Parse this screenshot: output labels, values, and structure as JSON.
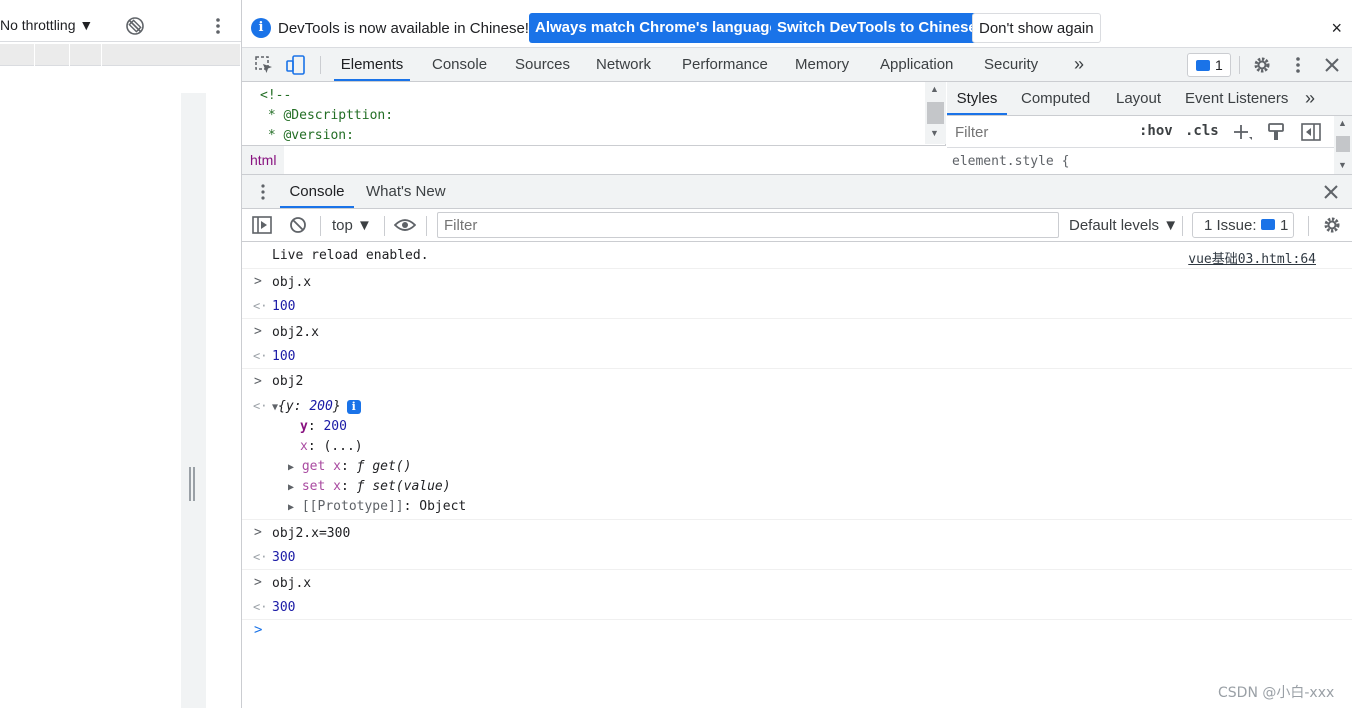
{
  "device_toolbar": {
    "throttling": "No throttling",
    "rotate_icon": "rotate-icon",
    "more_icon": "kebab-icon"
  },
  "infobar": {
    "message": "DevTools is now available in Chinese!",
    "btn_match": "Always match Chrome's language",
    "btn_switch": "Switch DevTools to Chinese",
    "btn_dismiss": "Don't show again",
    "close": "×"
  },
  "main_tabs": [
    "Elements",
    "Console",
    "Sources",
    "Network",
    "Performance",
    "Memory",
    "Application",
    "Security"
  ],
  "more_tabs": "»",
  "issues_count": "1",
  "elements": {
    "lines": [
      "<!--",
      " * @Descripttion:",
      " * @version:"
    ],
    "breadcrumb": "html"
  },
  "styles": {
    "tabs": [
      "Styles",
      "Computed",
      "Layout",
      "Event Listeners"
    ],
    "filter_placeholder": "Filter",
    "hov": ":hov",
    "cls": ".cls",
    "element_style": "element.style {"
  },
  "drawer": {
    "tabs": [
      "Console",
      "What's New"
    ]
  },
  "console_toolbar": {
    "context": "top",
    "filter_placeholder": "Filter",
    "levels": "Default levels",
    "issues_label": "1 Issue:",
    "issues_count": "1"
  },
  "console": {
    "live_reload": "Live reload enabled.",
    "source": "vue基础03.html:64",
    "entries": [
      {
        "input": "obj.x",
        "output": "100"
      },
      {
        "input": "obj2.x",
        "output": "100"
      },
      {
        "input": "obj2"
      },
      {
        "input": "obj2.x=300",
        "output": "300"
      },
      {
        "input": "obj.x",
        "output": "300"
      }
    ],
    "object": {
      "summary_open": "{",
      "summary_key": "y",
      "summary_val": "200",
      "summary_close": "}",
      "y_key": "y",
      "y_val": "200",
      "x_key": "x",
      "x_val": "(...)",
      "get_label": "get x",
      "get_fn": "get()",
      "set_label": "set x",
      "set_fn": "set(value)",
      "proto_key": "[[Prototype]]",
      "proto_val": "Object",
      "fn_glyph": "ƒ"
    }
  },
  "watermark": "CSDN @小白-xxx"
}
